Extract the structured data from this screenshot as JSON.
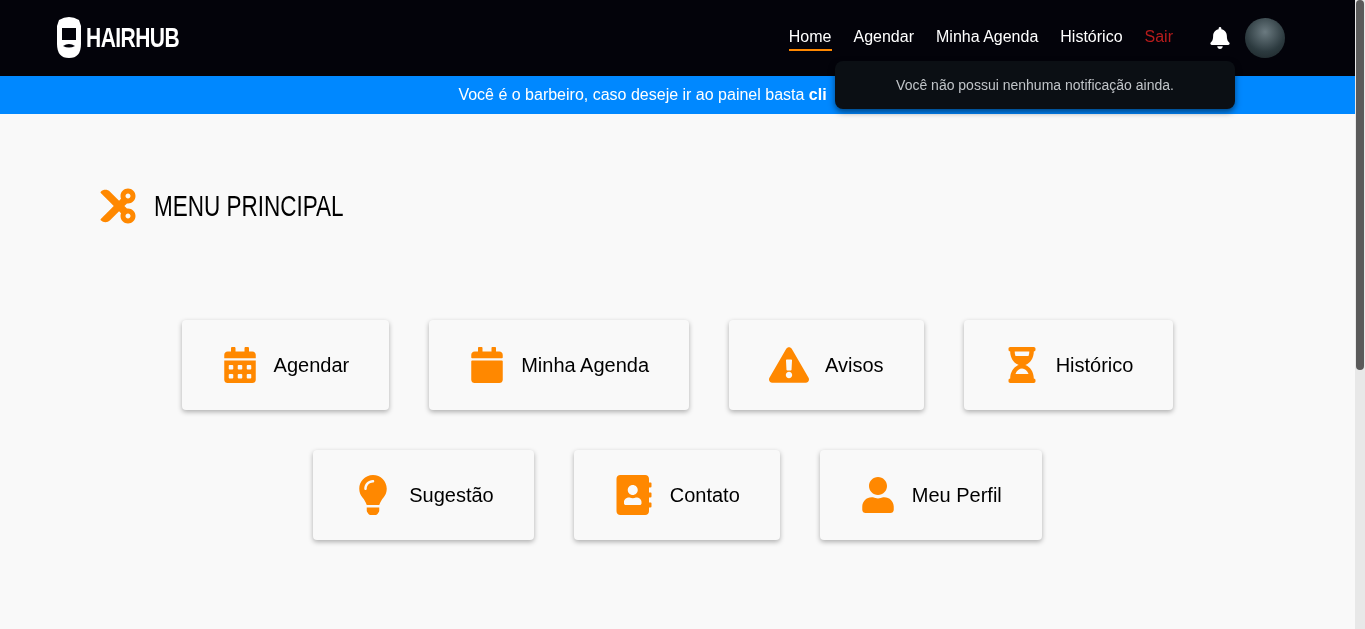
{
  "header": {
    "logo": "HAIRHUB",
    "nav": [
      {
        "label": "Home",
        "selected": true,
        "kind": "link"
      },
      {
        "label": "Agendar",
        "selected": false,
        "kind": "link"
      },
      {
        "label": "Minha Agenda",
        "selected": false,
        "kind": "link"
      },
      {
        "label": "Histórico",
        "selected": false,
        "kind": "link"
      },
      {
        "label": "Sair",
        "selected": false,
        "kind": "logout"
      }
    ]
  },
  "notification_popup": {
    "message": "Você não possui nenhuma notificação ainda."
  },
  "banner": {
    "text": "Você é o barbeiro, caso deseje ir ao painel basta **cli**"
  },
  "title": "MENU PRINCIPAL",
  "menu_rows": [
    [
      {
        "label": "Agendar",
        "kind": "calendar-grid"
      },
      {
        "label": "Minha Agenda",
        "kind": "calendar"
      },
      {
        "label": "Avisos",
        "kind": "warning"
      },
      {
        "label": "Histórico",
        "kind": "hourglass"
      }
    ],
    [
      {
        "label": "Sugestão",
        "kind": "bulb"
      },
      {
        "label": "Contato",
        "kind": "contact"
      },
      {
        "label": "Meu Perfil",
        "kind": "user"
      }
    ]
  ]
}
